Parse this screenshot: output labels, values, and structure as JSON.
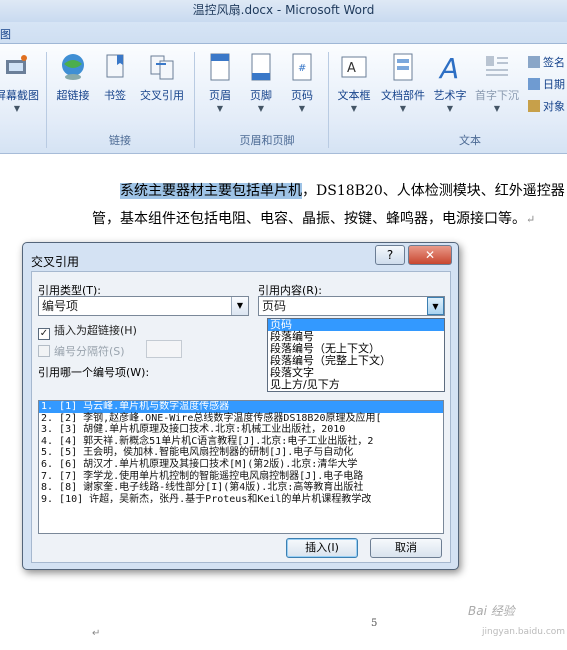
{
  "window": {
    "title": "温控风扇.docx - Microsoft Word",
    "tab_partial": "图"
  },
  "ribbon": {
    "buttons": [
      {
        "id": "screenshot",
        "label": "屏幕截图"
      },
      {
        "id": "hyperlink",
        "label": "超链接"
      },
      {
        "id": "bookmark",
        "label": "书签"
      },
      {
        "id": "crossref",
        "label": "交叉引用"
      },
      {
        "id": "header",
        "label": "页眉"
      },
      {
        "id": "footer",
        "label": "页脚"
      },
      {
        "id": "pagenum",
        "label": "页码"
      },
      {
        "id": "textbox",
        "label": "文本框"
      },
      {
        "id": "docparts",
        "label": "文档部件"
      },
      {
        "id": "wordart",
        "label": "艺术字"
      },
      {
        "id": "dropcap",
        "label": "首字下沉"
      }
    ],
    "side_items": [
      "签名",
      "日期",
      "对象"
    ],
    "groups": {
      "links": "链接",
      "header_footer": "页眉和页脚",
      "text": "文本"
    }
  },
  "document": {
    "line1_highlight": "系统主要器材主要包括单片机",
    "line1_rest": "，DS18B20、人体检测模块、红外遥控器",
    "line2": "管，基本组件还包括电阻、电容、晶振、按键、蜂鸣器，电源接口等。",
    "para_mark": "↵",
    "page_number": "5",
    "bottom_mark": "↵"
  },
  "dialog": {
    "title": "交叉引用",
    "help_label": "?",
    "close_label": "✕",
    "ref_type_label": "引用类型(T):",
    "ref_type_value": "编号项",
    "ref_content_label": "引用内容(R):",
    "ref_content_value": "页码",
    "insert_hyperlink_label": "插入为超链接(H)",
    "insert_hyperlink_check": "✓",
    "separator_label": "编号分隔符(S)",
    "which_item_label": "引用哪一个编号项(W):",
    "items": [
      "1.  [1] 马云峰.单片机与数字温度传感器",
      "2.  [2] 李钢,赵彦峰.ONE-Wire总线数字温度传感器DS18B20原理及应用[",
      "3.  [3] 胡健.单片机原理及接口技术.北京:机械工业出版社，2010",
      "4.  [4] 郭天祥.新概念51单片机C语言教程[J].北京:电子工业出版社，2",
      "5.  [5] 王会明，侯加林.智能电风扇控制器的研制[J].电子与自动化",
      "6.  [6] 胡汉才.单片机原理及其接口技术[M](第2版).北京:清华大学",
      "7.  [7] 李学龙.使用单片机控制的智能遥控电风扇控制器[J].电子电路",
      "8.  [8] 谢家奎.电子线路-线性部分[I](第4版).北京:高等教育出版社",
      "9.  [10] 许超，吴新杰，张丹.基于Proteus和Keil的单片机课程教学改"
    ],
    "selected_item_index": 0,
    "content_options": [
      "页码",
      "段落编号",
      "段落编号（无上下文）",
      "段落编号（完整上下文）",
      "段落文字",
      "见上方/见下方"
    ],
    "selected_option_index": 0,
    "insert_button": "插入(I)",
    "cancel_button": "取消"
  },
  "watermark": {
    "line1": "Bai 经验",
    "line2": "jingyan.baidu.com"
  },
  "colors": {
    "selection": "#3399ff",
    "highlight": "#9ec3e6",
    "ribbon_text": "#15428b"
  }
}
